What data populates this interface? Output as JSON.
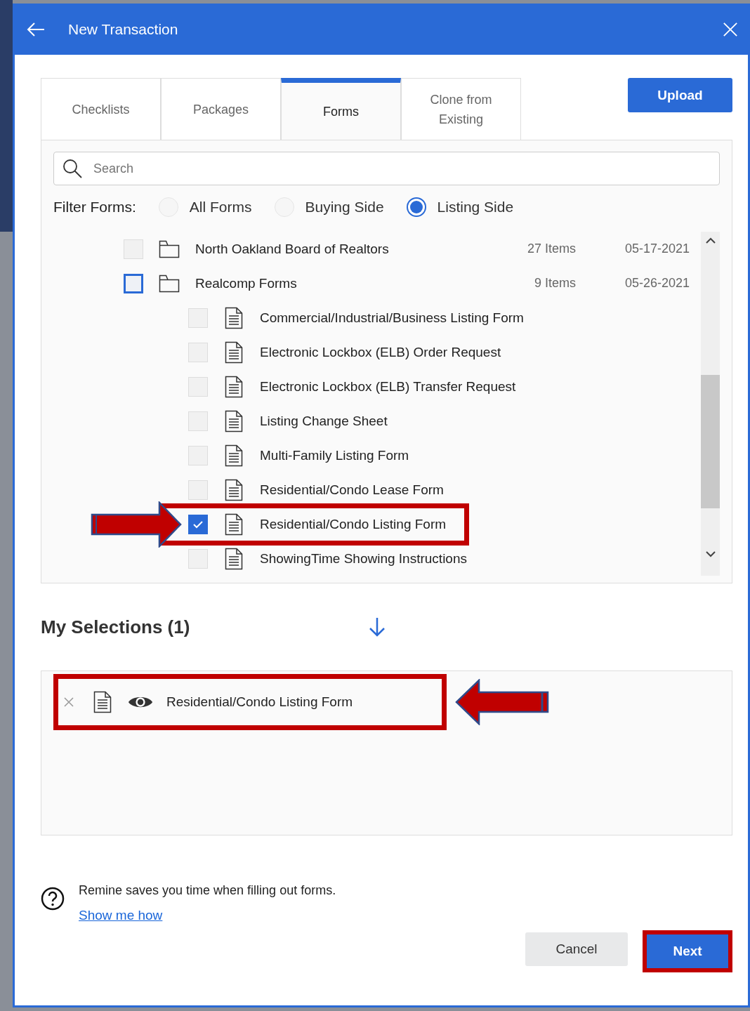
{
  "header": {
    "title": "New Transaction"
  },
  "tabs": [
    {
      "label": "Checklists",
      "selected": false
    },
    {
      "label": "Packages",
      "selected": false
    },
    {
      "label": "Forms",
      "selected": true
    },
    {
      "label": "Clone from Existing",
      "selected": false
    }
  ],
  "upload_button": "Upload",
  "search": {
    "placeholder": "Search"
  },
  "filter": {
    "label": "Filter Forms:",
    "options": [
      {
        "label": "All Forms",
        "selected": false
      },
      {
        "label": "Buying Side",
        "selected": false
      },
      {
        "label": "Listing Side",
        "selected": true
      }
    ]
  },
  "folders": [
    {
      "name": "North Oakland Board of Realtors",
      "count": "27 Items",
      "date": "05-17-2021",
      "checked": false,
      "indeterminate": false
    },
    {
      "name": "Realcomp Forms",
      "count": "9 Items",
      "date": "05-26-2021",
      "checked": false,
      "indeterminate": true,
      "children": [
        {
          "name": "Commercial/Industrial/Business Listing Form",
          "checked": false,
          "highlighted": false
        },
        {
          "name": "Electronic Lockbox (ELB) Order Request",
          "checked": false,
          "highlighted": false
        },
        {
          "name": "Electronic Lockbox (ELB) Transfer Request",
          "checked": false,
          "highlighted": false
        },
        {
          "name": "Listing Change Sheet",
          "checked": false,
          "highlighted": false
        },
        {
          "name": "Multi-Family Listing Form",
          "checked": false,
          "highlighted": false
        },
        {
          "name": "Residential/Condo Lease Form",
          "checked": false,
          "highlighted": false
        },
        {
          "name": "Residential/Condo Listing Form",
          "checked": true,
          "highlighted": true
        },
        {
          "name": "ShowingTime Showing Instructions",
          "checked": false,
          "highlighted": false
        }
      ]
    }
  ],
  "selections": {
    "title": "My Selections (1)",
    "items": [
      {
        "name": "Residential/Condo Listing Form",
        "highlighted": true
      }
    ]
  },
  "help": {
    "text": "Remine saves you time when filling out forms.",
    "link": "Show me how"
  },
  "buttons": [
    {
      "label": "Cancel",
      "kind": "secondary",
      "highlighted": false
    },
    {
      "label": "Next",
      "kind": "primary",
      "highlighted": true
    }
  ]
}
